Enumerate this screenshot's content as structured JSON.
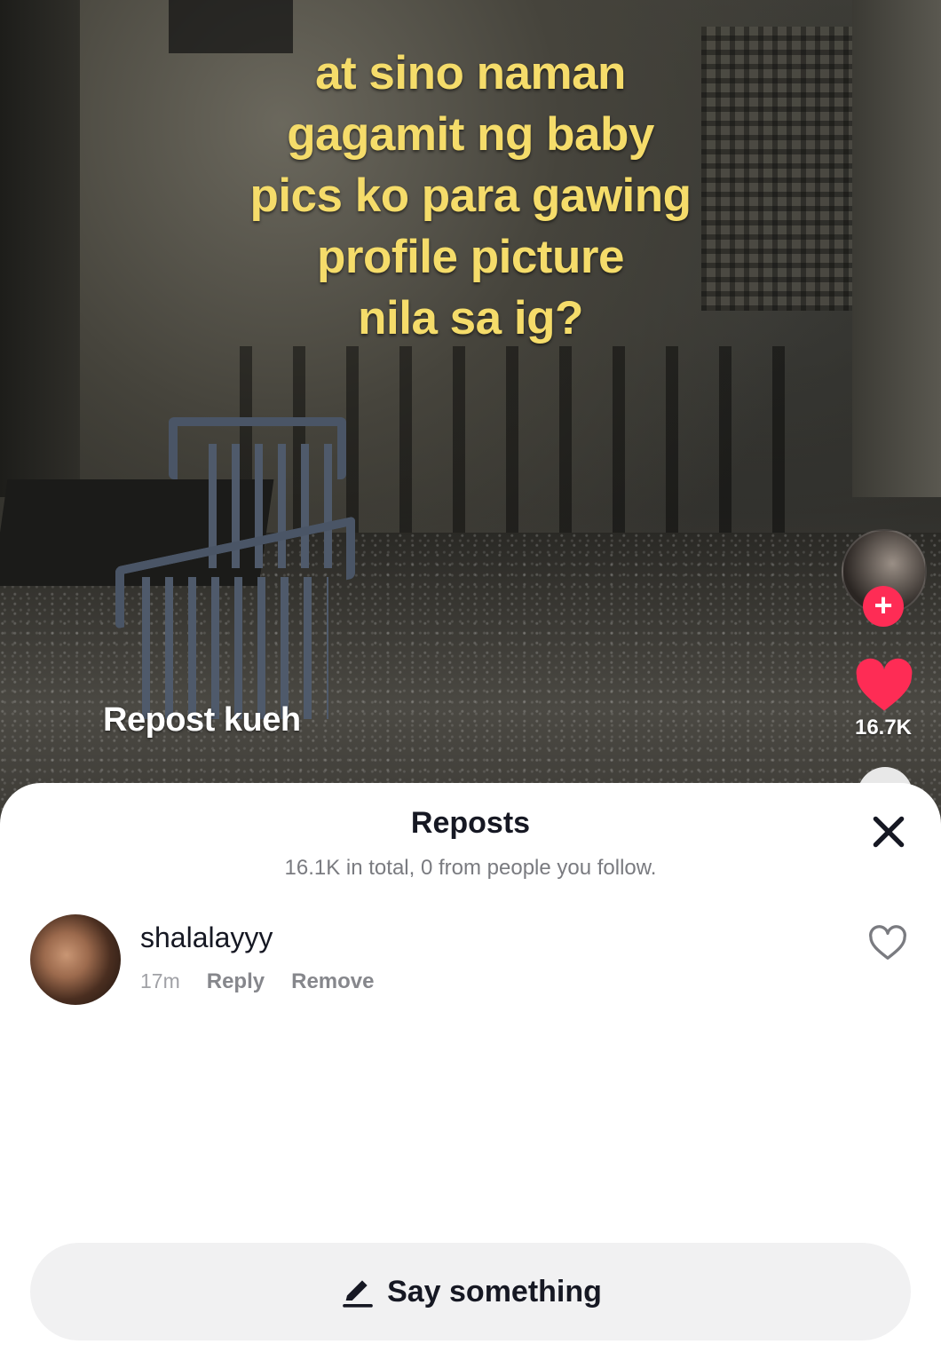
{
  "video": {
    "overlay_text": "at sino naman\ngagamit ng baby\npics ko para gawing\nprofile picture\nnila sa ig?",
    "caption": "Repost kueh",
    "like_count": "16.7K",
    "follow_symbol": "+"
  },
  "sheet": {
    "title": "Reposts",
    "subtitle": "16.1K in total, 0 from people you follow.",
    "close_icon": "close-icon",
    "items": [
      {
        "username": "shalalayyy",
        "time": "17m",
        "reply_label": "Reply",
        "remove_label": "Remove"
      }
    ],
    "input_placeholder": "Say something"
  },
  "colors": {
    "overlay_text": "#f5dc6a",
    "accent": "#fe2c55",
    "sheet_bg": "#ffffff",
    "input_bg": "#f1f1f2"
  }
}
